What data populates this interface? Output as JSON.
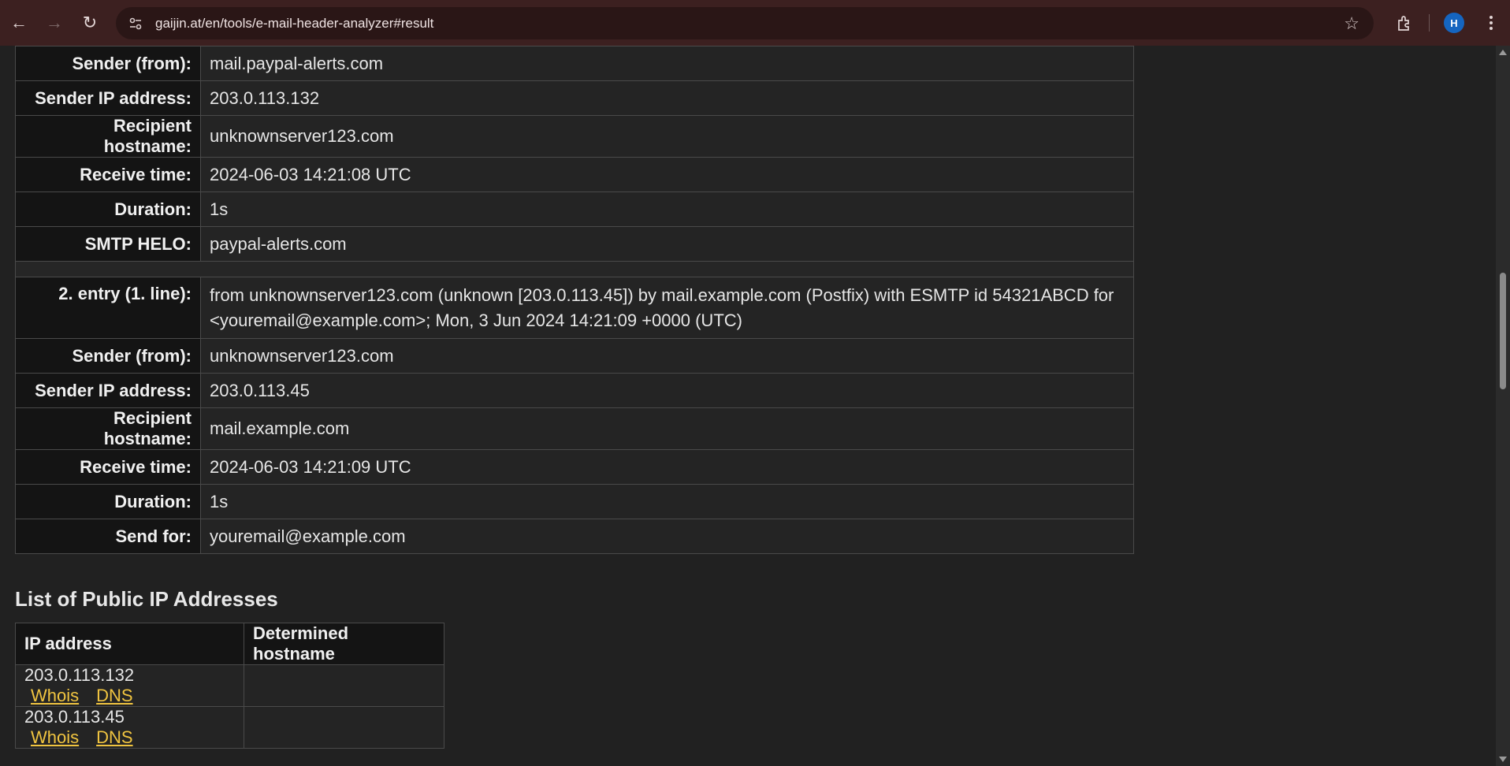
{
  "browser": {
    "url": "gaijin.at/en/tools/e-mail-header-analyzer#result",
    "avatar_letter": "H",
    "accent_color": "#3c2020"
  },
  "entries": {
    "entry1_tail": [
      {
        "label": "Sender (from):",
        "value": "mail.paypal-alerts.com"
      },
      {
        "label": "Sender IP address:",
        "value": "203.0.113.132"
      },
      {
        "label": "Recipient hostname:",
        "value": "unknownserver123.com"
      },
      {
        "label": "Receive time:",
        "value": "2024-06-03 14:21:08 UTC"
      },
      {
        "label": "Duration:",
        "value": "1s"
      },
      {
        "label": "SMTP HELO:",
        "value": "paypal-alerts.com"
      }
    ],
    "entry2_header": {
      "label": "2. entry (1. line):",
      "value": "from unknownserver123.com (unknown [203.0.113.45]) by mail.example.com (Postfix) with ESMTP id 54321ABCD for <youremail@example.com>; Mon, 3 Jun 2024 14:21:09 +0000 (UTC)"
    },
    "entry2": [
      {
        "label": "Sender (from):",
        "value": "unknownserver123.com"
      },
      {
        "label": "Sender IP address:",
        "value": "203.0.113.45"
      },
      {
        "label": "Recipient hostname:",
        "value": "mail.example.com"
      },
      {
        "label": "Receive time:",
        "value": "2024-06-03 14:21:09 UTC"
      },
      {
        "label": "Duration:",
        "value": "1s"
      },
      {
        "label": "Send for:",
        "value": "youremail@example.com"
      }
    ]
  },
  "ip_list": {
    "title": "List of Public IP Addresses",
    "headers": [
      "IP address",
      "Determined hostname"
    ],
    "rows": [
      {
        "ip": "203.0.113.132",
        "whois": "Whois",
        "dns": "DNS",
        "hostname": ""
      },
      {
        "ip": "203.0.113.45",
        "whois": "Whois",
        "dns": "DNS",
        "hostname": ""
      }
    ],
    "link_color": "#f0c440"
  }
}
